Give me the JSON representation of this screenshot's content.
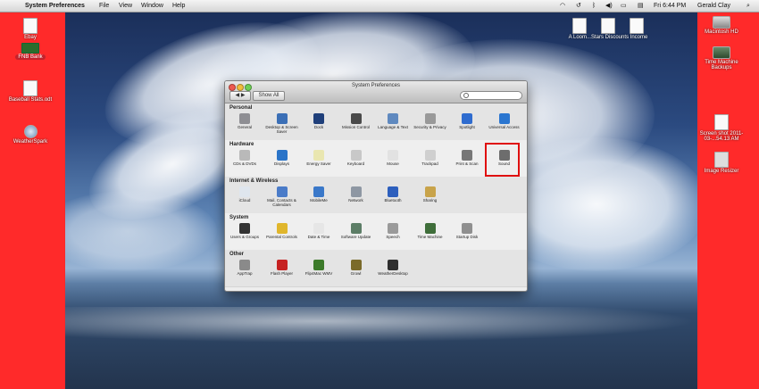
{
  "menubar": {
    "app_name": "System Preferences",
    "menus": [
      "File",
      "View",
      "Window",
      "Help"
    ],
    "clock": "Fri 6:44 PM",
    "user": "Gerald Clay"
  },
  "desktop_left": [
    {
      "label": "Ebay",
      "icon": "document-icon"
    },
    {
      "label": "FNB Bank",
      "icon": "bank-icon"
    },
    {
      "label": "Baseball Stats.odt",
      "icon": "document-icon"
    },
    {
      "label": "WeatherSpark",
      "icon": "globe-icon"
    }
  ],
  "desktop_top": {
    "label": "A Loom...Stars Discounts Income"
  },
  "desktop_right": [
    {
      "label": "Macintosh HD"
    },
    {
      "label": "Time Machine Backups"
    },
    {
      "label": "Screen shot 2011-03-...54.13 AM"
    },
    {
      "label": "Image Resizer"
    }
  ],
  "window": {
    "title": "System Preferences",
    "show_all": "Show All",
    "search_placeholder": "",
    "sections": [
      {
        "title": "Personal",
        "items": [
          {
            "label": "General",
            "color": "#8e8e93"
          },
          {
            "label": "Desktop & Screen Saver",
            "color": "#3b6fb6"
          },
          {
            "label": "Dock",
            "color": "#1f3f7a"
          },
          {
            "label": "Mission Control",
            "color": "#4a4a4a"
          },
          {
            "label": "Language & Text",
            "color": "#5f89bf"
          },
          {
            "label": "Security & Privacy",
            "color": "#999999"
          },
          {
            "label": "Spotlight",
            "color": "#2f6ccf"
          },
          {
            "label": "Universal Access",
            "color": "#2b76d0"
          }
        ]
      },
      {
        "title": "Hardware",
        "items": [
          {
            "label": "CDs & DVDs",
            "color": "#b9b9b9"
          },
          {
            "label": "Displays",
            "color": "#2a74c8"
          },
          {
            "label": "Energy Saver",
            "color": "#e9e6b0"
          },
          {
            "label": "Keyboard",
            "color": "#c8c8c8"
          },
          {
            "label": "Mouse",
            "color": "#e2e2e2"
          },
          {
            "label": "Trackpad",
            "color": "#cfcfcf"
          },
          {
            "label": "Print & Scan",
            "color": "#777777"
          },
          {
            "label": "Sound",
            "color": "#6d6d6d"
          }
        ]
      },
      {
        "title": "Internet & Wireless",
        "items": [
          {
            "label": "iCloud",
            "color": "#dfe6ee"
          },
          {
            "label": "Mail, Contacts & Calendars",
            "color": "#4a7bc8"
          },
          {
            "label": "MobileMe",
            "color": "#3a78c9"
          },
          {
            "label": "Network",
            "color": "#8e97a3"
          },
          {
            "label": "Bluetooth",
            "color": "#2d5fbd"
          },
          {
            "label": "Sharing",
            "color": "#c8a34a"
          }
        ]
      },
      {
        "title": "System",
        "items": [
          {
            "label": "Users & Groups",
            "color": "#333333"
          },
          {
            "label": "Parental Controls",
            "color": "#e0b62c"
          },
          {
            "label": "Date & Time",
            "color": "#e6e6e6"
          },
          {
            "label": "Software Update",
            "color": "#5c7d66"
          },
          {
            "label": "Speech",
            "color": "#9a9a9a"
          },
          {
            "label": "Time Machine",
            "color": "#3f6e3a"
          },
          {
            "label": "Startup Disk",
            "color": "#8f8f8f"
          }
        ]
      },
      {
        "title": "Other",
        "items": [
          {
            "label": "AppTrap",
            "color": "#8a8a8a"
          },
          {
            "label": "Flash Player",
            "color": "#c62222"
          },
          {
            "label": "Flip4Mac WMV",
            "color": "#3c7a2a"
          },
          {
            "label": "Growl",
            "color": "#7a6a2a"
          },
          {
            "label": "WeatherDesktop",
            "color": "#2f2f2f"
          }
        ]
      }
    ]
  },
  "accent_colors": {
    "highlight_border": "#e01010",
    "side_panels": "#ff2a2a"
  }
}
